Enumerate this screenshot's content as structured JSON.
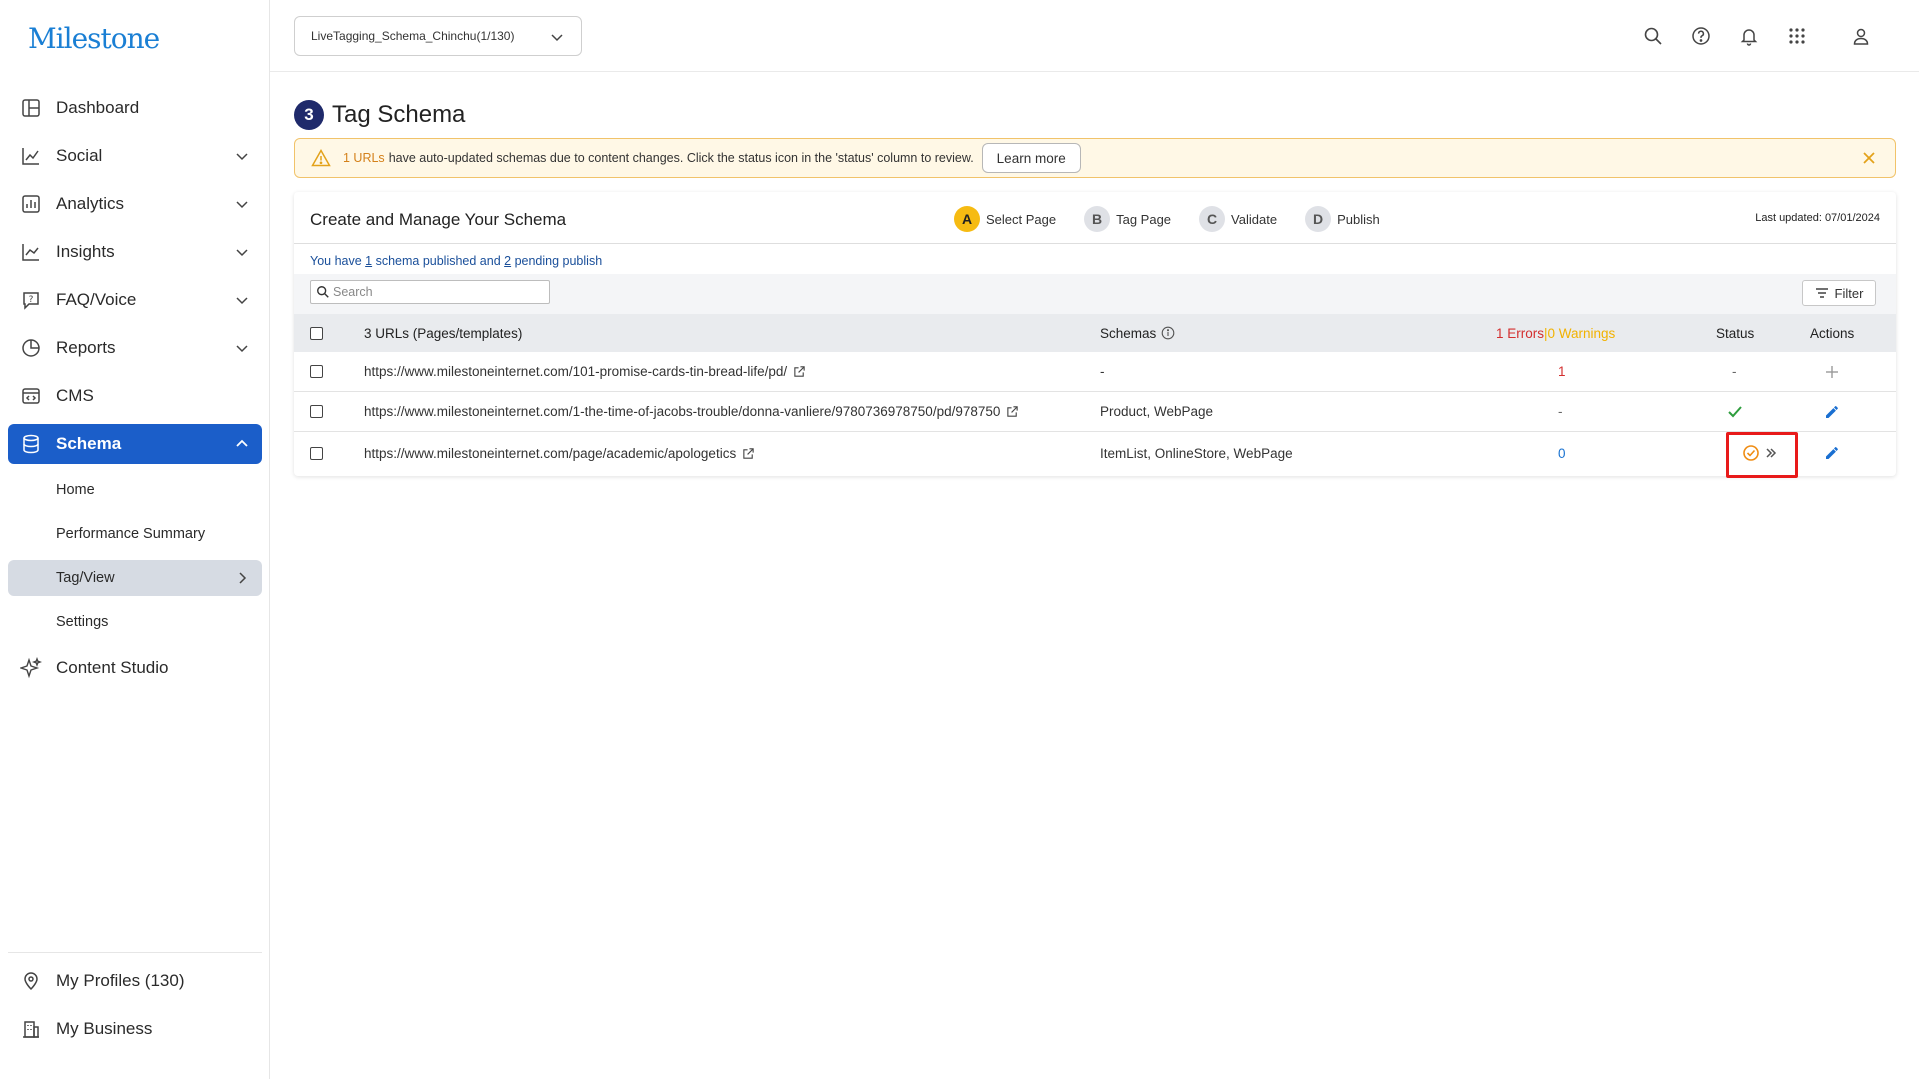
{
  "app": {
    "logo": "Milestone"
  },
  "sidebar": {
    "items": [
      {
        "label": "Dashboard"
      },
      {
        "label": "Social"
      },
      {
        "label": "Analytics"
      },
      {
        "label": "Insights"
      },
      {
        "label": "FAQ/Voice"
      },
      {
        "label": "Reports"
      },
      {
        "label": "CMS"
      },
      {
        "label": "Schema"
      }
    ],
    "sub_items": [
      {
        "label": "Home"
      },
      {
        "label": "Performance Summary"
      },
      {
        "label": "Tag/View"
      },
      {
        "label": "Settings"
      }
    ],
    "content_studio": "Content Studio",
    "bottom": [
      {
        "label": "My Profiles (130)"
      },
      {
        "label": "My Business"
      }
    ]
  },
  "topbar": {
    "profile_selector": "LiveTagging_Schema_Chinchu(1/130)",
    "icons": [
      "search-icon",
      "help-icon",
      "bell-icon",
      "apps-grid-icon",
      "user-icon"
    ]
  },
  "page": {
    "step_number": "3",
    "title": "Tag Schema"
  },
  "alert": {
    "count": "1 URLs",
    "message": "have auto-updated schemas due to content changes. Click the status icon in the 'status' column to review.",
    "button": "Learn more"
  },
  "card": {
    "title": "Create and Manage Your Schema",
    "steps": [
      {
        "letter": "A",
        "label": "Select Page"
      },
      {
        "letter": "B",
        "label": "Tag Page"
      },
      {
        "letter": "C",
        "label": "Validate"
      },
      {
        "letter": "D",
        "label": "Publish"
      }
    ],
    "last_updated": "Last updated: 07/01/2024",
    "summary": {
      "prefix": "You have ",
      "published": "1",
      "middle": " schema published and ",
      "pending": "2",
      "suffix": " pending publish"
    },
    "search_placeholder": "Search",
    "filter_label": "Filter"
  },
  "table": {
    "headers": {
      "urls": "3 URLs (Pages/templates)",
      "schemas": "Schemas",
      "errors": "1 Errors",
      "separator": " | ",
      "warnings": "0 Warnings",
      "status": "Status",
      "actions": "Actions"
    },
    "rows": [
      {
        "url": "https://www.milestoneinternet.com/101-promise-cards-tin-bread-life/pd/",
        "schemas": "-",
        "errors": "1",
        "status": "-",
        "action": "add"
      },
      {
        "url": "https://www.milestoneinternet.com/1-the-time-of-jacobs-trouble/donna-vanliere/9780736978750/pd/978750",
        "schemas": "Product, WebPage",
        "errors": "-",
        "status": "check",
        "action": "edit"
      },
      {
        "url": "https://www.milestoneinternet.com/page/academic/apologetics",
        "schemas": "ItemList, OnlineStore, WebPage",
        "errors": "0",
        "status": "auto-updated",
        "action": "edit"
      }
    ]
  },
  "colors": {
    "accent": "#1b5ec9",
    "step_active": "#f6bb12",
    "error": "#d32f2f",
    "warning": "#f2b200",
    "highlight_box": "#e81a1a"
  }
}
